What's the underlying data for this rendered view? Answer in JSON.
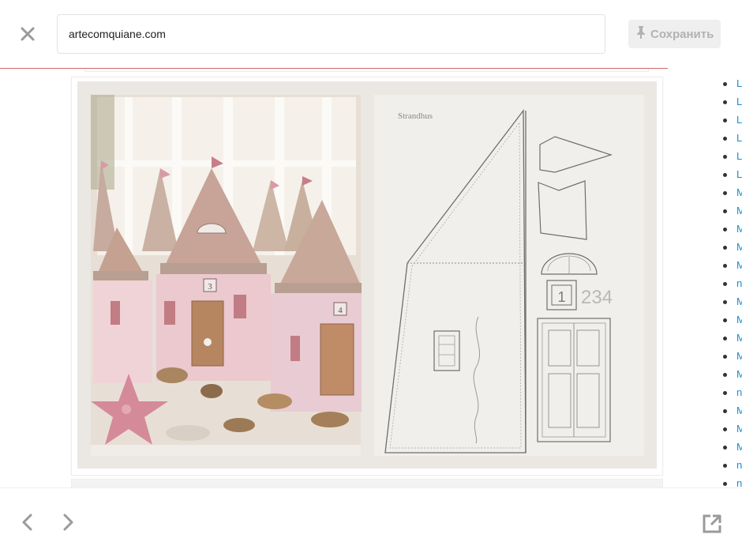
{
  "header": {
    "close_icon": "close-icon",
    "url": "artecomquiane.com",
    "save_label": "Сохранить",
    "save_icon": "pin-icon"
  },
  "sidebar": {
    "items": [
      "L",
      "L",
      "L",
      "L",
      "L",
      "L",
      "M",
      "M",
      "M",
      "M",
      "M",
      "n",
      "M",
      "M",
      "M",
      "M",
      "M",
      "n",
      "M",
      "M",
      "M",
      "n",
      "n"
    ]
  },
  "image": {
    "alt_text_visible": "",
    "left_panel": {
      "house_numbers": [
        "3",
        "4"
      ]
    },
    "right_panel": {
      "heading": "Strandhus",
      "number_box": "1",
      "numbers_rest": "234"
    }
  },
  "footer": {
    "prev_icon": "chevron-left-icon",
    "next_icon": "chevron-right-icon",
    "open_external_icon": "external-link-icon"
  },
  "colors": {
    "link": "#1a8ed1",
    "accent_line": "#d26a6a",
    "save_bg": "#efefef",
    "save_text": "#b2b2b2"
  }
}
